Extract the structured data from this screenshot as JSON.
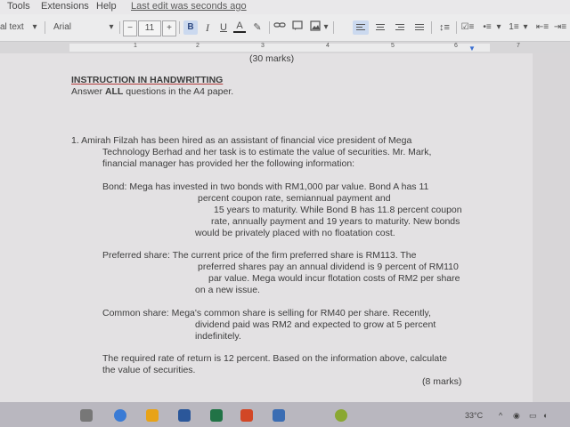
{
  "menubar": {
    "items": [
      "Tools",
      "Extensions",
      "Help"
    ],
    "last_edit": "Last edit was seconds ago"
  },
  "toolbar": {
    "style": "al text",
    "font": "Arial",
    "font_size": "11",
    "minus": "−",
    "plus": "+",
    "bold": "B",
    "italic": "I",
    "underline": "U",
    "text_color": "A"
  },
  "ruler": {
    "marks": [
      "1",
      "2",
      "3",
      "4",
      "5",
      "6",
      "7"
    ]
  },
  "doc": {
    "marks_top": "(30 marks)",
    "heading": "INSTRUCTION IN HANDWRITTING",
    "sub_prefix": "Answer ",
    "sub_all": "ALL",
    "sub_suffix": " questions in the A4 paper.",
    "q_lines": [
      "1.  Amirah Filzah has been hired as an assistant of financial vice president of Mega",
      "Technology Berhad and her task is to estimate the value of securities. Mr. Mark,",
      "financial manager has provided her the following information:"
    ],
    "bond_lines": [
      "Bond: Mega has invested in two bonds with RM1,000 par value.  Bond A has 11",
      "percent coupon rate, semiannual payment and",
      "15 years to maturity. While Bond B has 11.8 percent coupon",
      "rate, annually payment and 19 years to maturity. New bonds",
      "would be privately placed with no floatation cost."
    ],
    "pref_lines": [
      "Preferred share: The current price of the firm preferred share is RM113. The",
      "preferred shares pay an annual dividend is 9 percent of RM110",
      "par value. Mega would incur flotation costs of RM2 per share",
      "on a new issue."
    ],
    "common_lines": [
      "Common share: Mega's common share is selling for RM40 per share. Recently,",
      "dividend paid was RM2 and expected to grow at 5 percent",
      "indefinitely."
    ],
    "required_lines": [
      "The required rate of return is 12 percent. Based on the information above, calculate",
      "the value of securities."
    ],
    "marks_bottom": "(8 marks)"
  },
  "taskbar": {
    "temperature": "33°C",
    "icon_colors": [
      "#3a7bd5",
      "#e8a317",
      "#2b579a",
      "#217346",
      "#d24726",
      "#3b6db3",
      "#8aa832"
    ]
  }
}
